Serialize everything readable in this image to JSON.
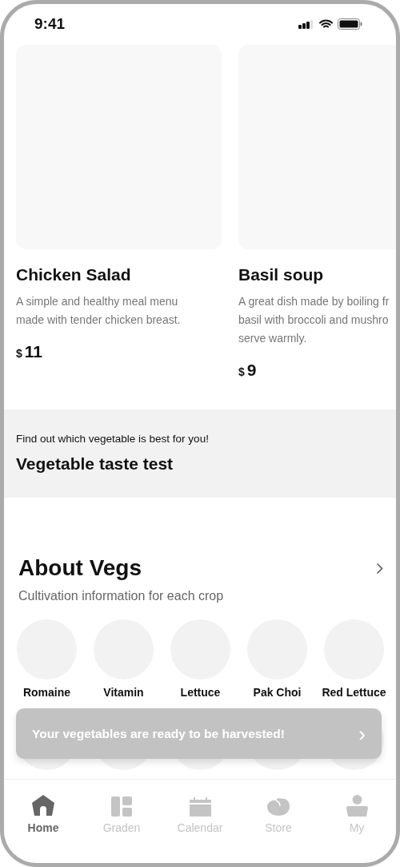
{
  "status_bar": {
    "time": "9:41"
  },
  "meals": [
    {
      "title": "Chicken Salad",
      "description_lines": [
        "A simple and healthy meal menu",
        "made with tender chicken breast."
      ],
      "currency": "$",
      "price": "11"
    },
    {
      "title": "Basil soup",
      "description_lines": [
        "A great dish made by boiling fr",
        "basil with broccoli and mushro",
        "serve warmly."
      ],
      "currency": "$",
      "price": "9"
    }
  ],
  "banner": {
    "caption": "Find out which vegetable is best for you!",
    "title": "Vegetable taste test"
  },
  "about": {
    "title": "About Vegs",
    "subtitle": "Cultivation information for each crop",
    "crops": [
      "Romaine",
      "Vitamin",
      "Lettuce",
      "Pak Choi",
      "Red Lettuce"
    ]
  },
  "toast": {
    "message": "Your vegetables are ready to be harvested!",
    "arrow": "›"
  },
  "tab_bar": [
    {
      "label": "Home",
      "kind": "home",
      "selected": true
    },
    {
      "label": "Graden",
      "kind": "garden",
      "selected": false
    },
    {
      "label": "Calendar",
      "kind": "calendar",
      "selected": false
    },
    {
      "label": "Store",
      "kind": "store",
      "selected": false
    },
    {
      "label": "My",
      "kind": "my",
      "selected": false
    }
  ]
}
